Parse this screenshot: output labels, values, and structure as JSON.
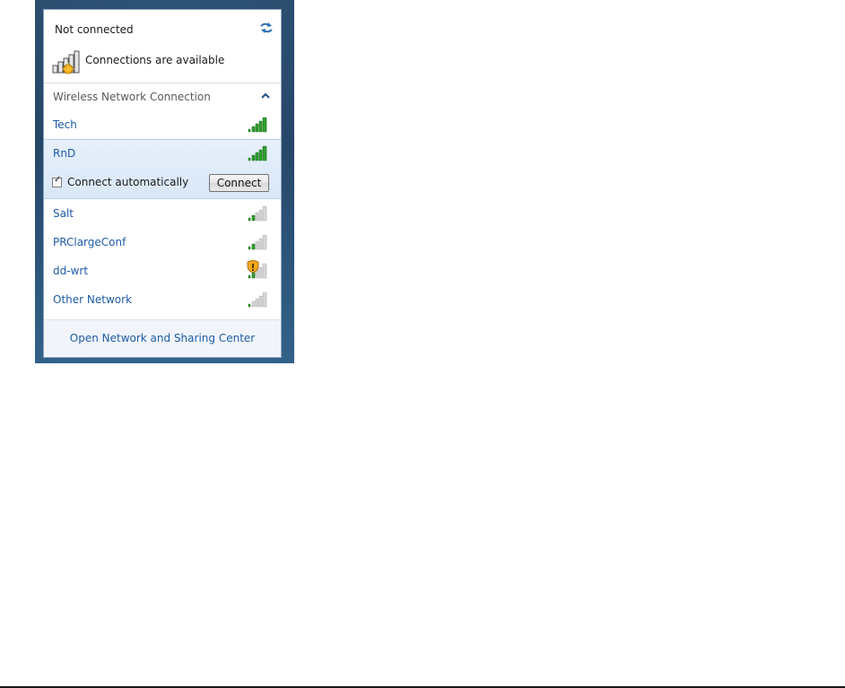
{
  "status": {
    "title": "Not connected",
    "availability": "Connections are available",
    "refresh_icon": "refresh-icon",
    "availability_icon": "network-warning-icon"
  },
  "section": {
    "title": "Wireless Network Connection",
    "toggle_icon": "chevron-up-icon"
  },
  "networks": [
    {
      "name": "Tech",
      "signal_bars": 5,
      "secured_badge": false
    },
    {
      "name": "RnD",
      "signal_bars": 5,
      "secured_badge": false,
      "selected": true
    },
    {
      "name": "Salt",
      "signal_bars": 2,
      "secured_badge": false
    },
    {
      "name": "PRClargeConf",
      "signal_bars": 2,
      "secured_badge": false
    },
    {
      "name": "dd-wrt",
      "signal_bars": 2,
      "secured_badge": true
    },
    {
      "name": "Other Network",
      "signal_bars": 1,
      "secured_badge": false
    }
  ],
  "selected_network": {
    "auto_connect_label": "Connect automatically",
    "auto_connect_checked": true,
    "connect_button": "Connect"
  },
  "footer": {
    "link": "Open Network and Sharing Center"
  },
  "colors": {
    "link_blue": "#1e5ba8",
    "signal_green": "#2ea02e",
    "signal_gray": "#b0b0b0",
    "selected_bg": "#dde9f8",
    "frame_blue": "#23476a"
  }
}
